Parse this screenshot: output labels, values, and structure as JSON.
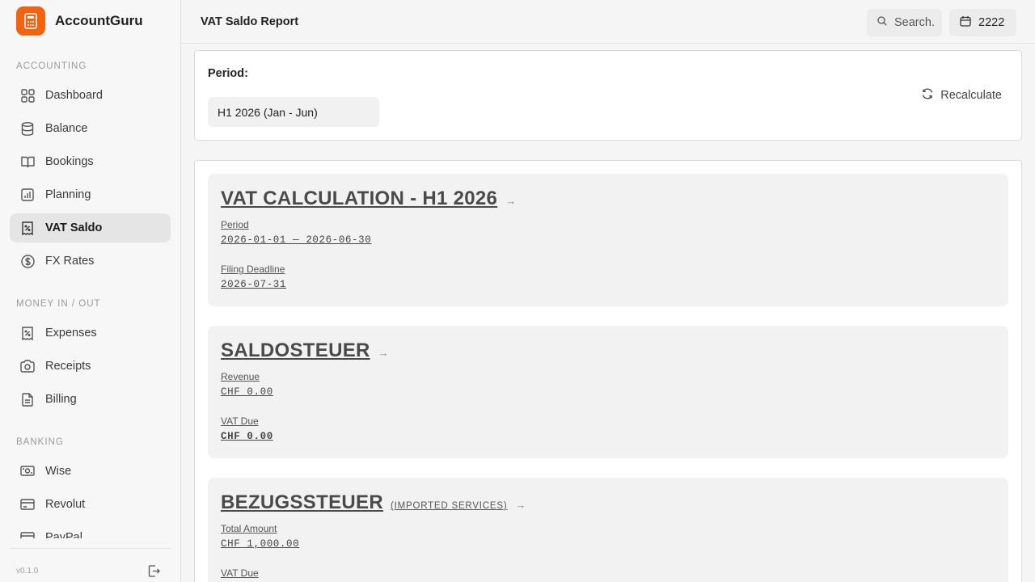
{
  "app": {
    "name": "AccountGuru",
    "version": "v0.1.0"
  },
  "sidebar": {
    "sections": [
      {
        "title": "ACCOUNTING",
        "items": [
          {
            "label": "Dashboard",
            "icon": "grid-icon"
          },
          {
            "label": "Balance",
            "icon": "database-icon"
          },
          {
            "label": "Bookings",
            "icon": "book-icon"
          },
          {
            "label": "Planning",
            "icon": "bar-chart-icon"
          },
          {
            "label": "VAT Saldo",
            "icon": "receipt-percent-icon",
            "active": true
          },
          {
            "label": "FX Rates",
            "icon": "dollar-circle-icon"
          }
        ]
      },
      {
        "title": "MONEY IN / OUT",
        "items": [
          {
            "label": "Expenses",
            "icon": "receipt-percent-icon"
          },
          {
            "label": "Receipts",
            "icon": "camera-icon"
          },
          {
            "label": "Billing",
            "icon": "file-text-icon"
          }
        ]
      },
      {
        "title": "BANKING",
        "items": [
          {
            "label": "Wise",
            "icon": "banknote-icon"
          },
          {
            "label": "Revolut",
            "icon": "credit-card-icon"
          },
          {
            "label": "PayPal",
            "icon": "credit-card-icon"
          }
        ]
      }
    ]
  },
  "header": {
    "title": "VAT Saldo Report",
    "search_label": "Search.",
    "year": "2222"
  },
  "period": {
    "label": "Period:",
    "selected": "H1 2026 (Jan - Jun)",
    "recalculate_label": "Recalculate"
  },
  "report": {
    "calculation": {
      "title": "VAT CALCULATION - H1 2026",
      "period_label": "Period",
      "period_value": "2026-01-01 — 2026-06-30",
      "deadline_label": "Filing Deadline",
      "deadline_value": "2026-07-31"
    },
    "saldosteuer": {
      "title": "SALDOSTEUER",
      "revenue_label": "Revenue",
      "revenue_value": "CHF 0.00",
      "vat_due_label": "VAT Due",
      "vat_due_value": "CHF 0.00"
    },
    "bezugssteuer": {
      "title": "BEZUGSSTEUER",
      "subtitle": "(IMPORTED SERVICES)",
      "total_label": "Total Amount",
      "total_value": "CHF 1,000.00",
      "vat_due_label": "VAT Due"
    }
  },
  "colors": {
    "brand": "#f2620f",
    "active_bg": "#e5e5e5"
  }
}
